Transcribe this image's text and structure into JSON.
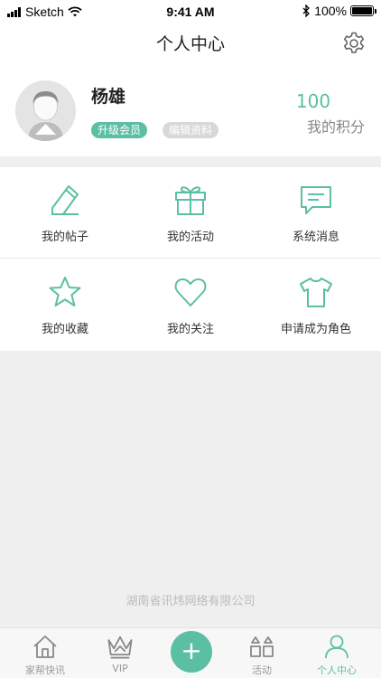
{
  "status_bar": {
    "carrier": "Sketch",
    "time": "9:41 AM",
    "battery": "100%"
  },
  "nav": {
    "title": "个人中心"
  },
  "profile": {
    "username": "杨雄",
    "upgrade_badge": "升级会员",
    "edit_badge": "编辑资料",
    "points_value": "100",
    "points_label": "我的积分"
  },
  "menu": {
    "items": [
      {
        "label": "我的帖子",
        "icon": "edit-icon"
      },
      {
        "label": "我的活动",
        "icon": "gift-icon"
      },
      {
        "label": "系统消息",
        "icon": "message-icon"
      },
      {
        "label": "我的收藏",
        "icon": "star-icon"
      },
      {
        "label": "我的关注",
        "icon": "heart-icon"
      },
      {
        "label": "申请成为角色",
        "icon": "shirt-icon"
      }
    ]
  },
  "footer": {
    "company": "湖南省讯炜网络有限公司"
  },
  "tab_bar": {
    "items": [
      {
        "label": "家帮快讯",
        "icon": "home-icon"
      },
      {
        "label": "VIP",
        "icon": "crown-icon"
      },
      {
        "label": "+",
        "icon": "plus-icon"
      },
      {
        "label": "活动",
        "icon": "grid-icon"
      },
      {
        "label": "个人中心",
        "icon": "person-icon"
      }
    ]
  },
  "colors": {
    "accent": "#5bbfa3",
    "background": "#efefef"
  }
}
